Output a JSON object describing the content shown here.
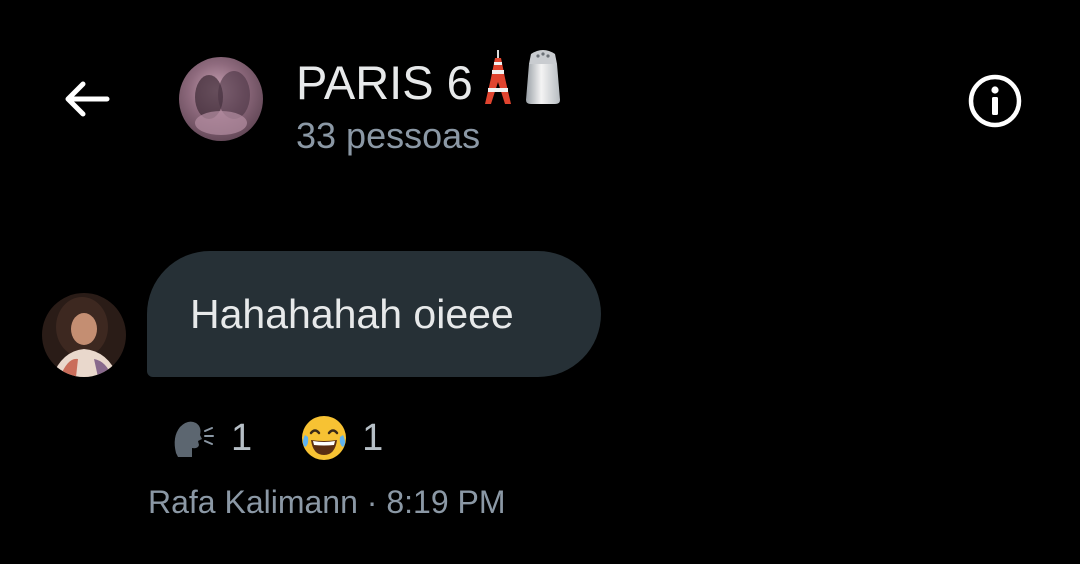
{
  "header": {
    "title": "PARIS 6",
    "title_emojis": [
      "tokyo-tower-icon",
      "salt-shaker-icon"
    ],
    "member_count": "33 pessoas",
    "back_icon": "arrow-left-icon",
    "info_icon": "info-circle-icon"
  },
  "message": {
    "text": "Hahahahah oieee",
    "sender": "Rafa Kalimann",
    "separator": "·",
    "time": "8:19 PM",
    "reactions": [
      {
        "icon": "speaking-head-icon",
        "count": "1"
      },
      {
        "icon": "face-with-tears-of-joy-icon",
        "count": "1"
      }
    ]
  },
  "colors": {
    "background": "#000000",
    "bubble": "#263036",
    "text_primary": "#e7e9ea",
    "text_secondary": "#8b98a5"
  }
}
